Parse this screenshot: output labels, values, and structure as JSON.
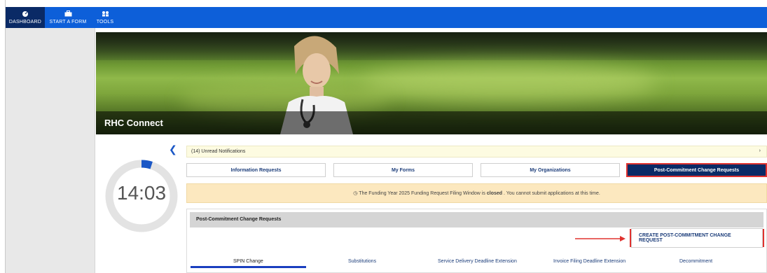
{
  "nav": {
    "items": [
      {
        "label": "DASHBOARD",
        "icon": "dashboard-icon",
        "active": true
      },
      {
        "label": "START A FORM",
        "icon": "briefcase-icon",
        "active": false
      },
      {
        "label": "TOOLS",
        "icon": "users-icon",
        "active": false
      }
    ]
  },
  "banner": {
    "title": "RHC Connect"
  },
  "timer": {
    "value": "14:03",
    "progress_fraction": 0.05
  },
  "notifications": {
    "label": "(14) Unread Notifications"
  },
  "tabs": [
    {
      "label": "Information Requests",
      "active": false
    },
    {
      "label": "My Forms",
      "active": false
    },
    {
      "label": "My Organizations",
      "active": false
    },
    {
      "label": "Post-Commitment Change Requests",
      "active": true
    }
  ],
  "alert": {
    "prefix": "The Funding Year 2025 Funding Request Filing Window is",
    "status": "closed",
    "suffix": ". You cannot submit applications at this time."
  },
  "panel": {
    "header": "Post-Commitment Change Requests",
    "create_button": "CREATE POST-COMMITMENT CHANGE REQUEST",
    "subtabs": [
      {
        "label": "SPIN Change",
        "active": true
      },
      {
        "label": "Substitutions",
        "active": false
      },
      {
        "label": "Service Delivery Deadline Extension",
        "active": false
      },
      {
        "label": "Invoice Filing Deadline Extension",
        "active": false
      },
      {
        "label": "Decommitment",
        "active": false
      }
    ]
  },
  "colors": {
    "nav_bg": "#0d5fd9",
    "nav_active": "#0a2a66",
    "highlight": "#e0322f",
    "timer_track": "#e3e3e3",
    "timer_progress": "#1a57c6"
  }
}
